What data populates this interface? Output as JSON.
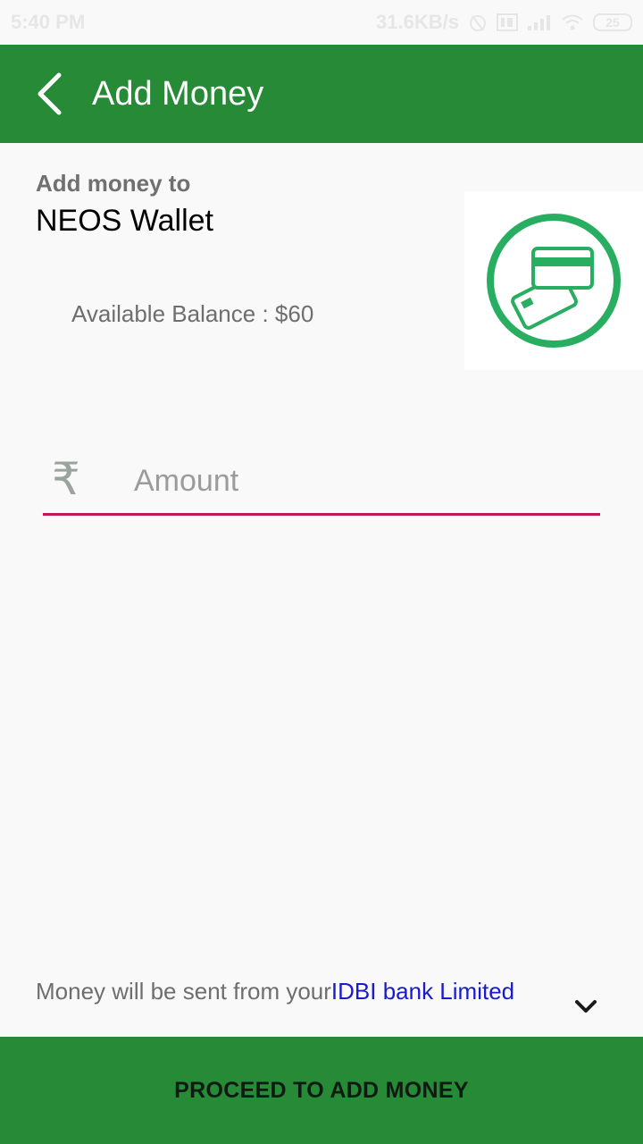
{
  "status_bar": {
    "time": "5:40 PM",
    "network_speed": "31.6KB/s",
    "battery": "25"
  },
  "header": {
    "title": "Add Money"
  },
  "wallet": {
    "label": "Add money to",
    "name": "NEOS Wallet",
    "balance_text": "Available Balance : $60"
  },
  "amount": {
    "currency_symbol": "₹",
    "placeholder": "Amount",
    "value": ""
  },
  "source": {
    "prefix": "Money will be sent from your",
    "bank": "IDBI bank Limited"
  },
  "footer": {
    "button_label": "PROCEED TO ADD MONEY"
  },
  "colors": {
    "primary": "#268a36",
    "accent": "#c2185b",
    "link": "#1a1acc",
    "wallet_icon": "#27ae60"
  },
  "icons": [
    "back-arrow-icon",
    "wallet-card-icon",
    "rupee-icon",
    "chevron-down-icon"
  ]
}
